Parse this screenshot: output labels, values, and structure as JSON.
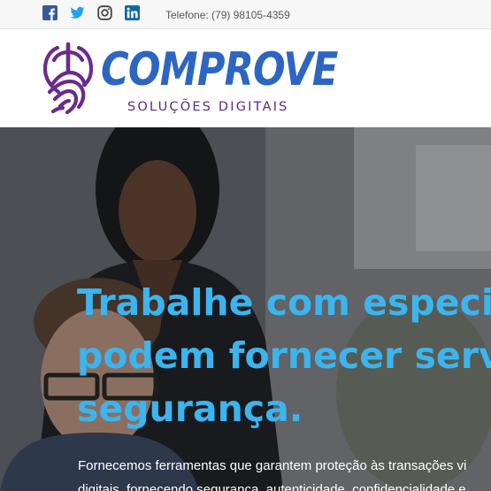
{
  "topbar": {
    "social": [
      {
        "icon": "facebook-icon",
        "color": "#3b5998"
      },
      {
        "icon": "twitter-icon",
        "color": "#1da1f2"
      },
      {
        "icon": "instagram-icon",
        "color": "#444444"
      },
      {
        "icon": "linkedin-icon",
        "color": "#0e6aa8"
      }
    ],
    "phone": "Telefone: (79) 98105-4359"
  },
  "logo": {
    "wordmark": "COMPROVE",
    "tagline": "SOLUÇÕES DIGITAIS",
    "primary_color": "#2d66c2",
    "secondary_color": "#5a2d82"
  },
  "hero": {
    "title_lines": [
      "Trabalhe com especial",
      "podem fornecer serviç",
      "segurança."
    ],
    "text_lines": [
      "Fornecemos ferramentas que garantem proteção às transações vi",
      "digitais, fornecendo segurança, autenticidade, confidencialidade e"
    ],
    "title_color": "#3cb4ee"
  }
}
